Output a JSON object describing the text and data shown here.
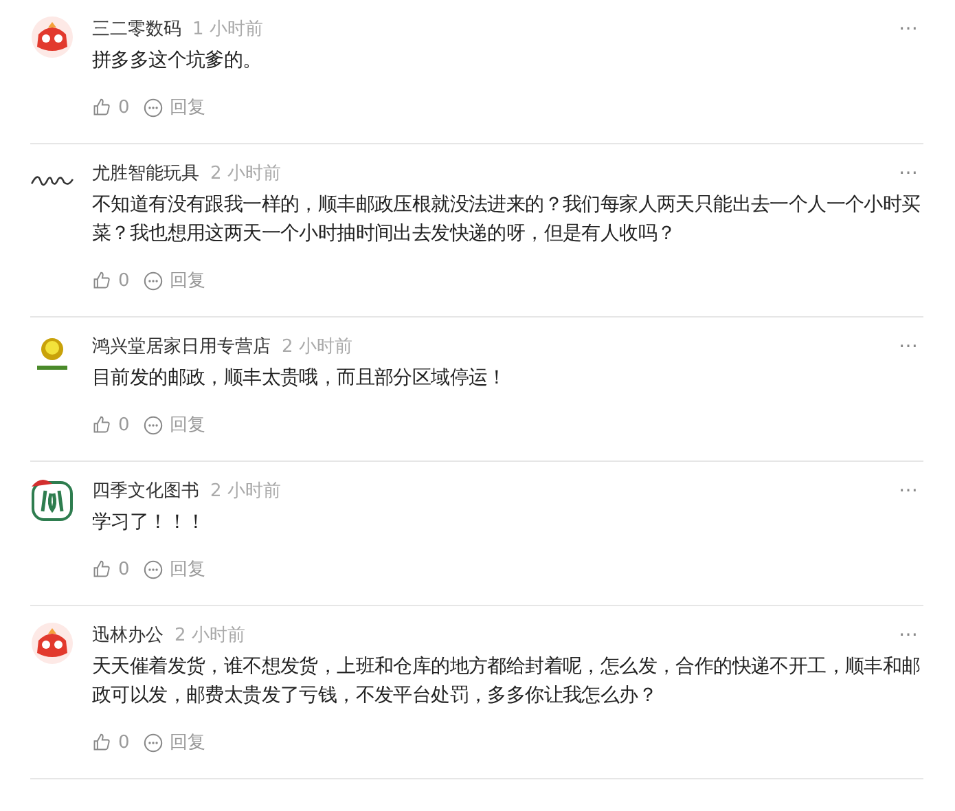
{
  "comments": [
    {
      "avatar": {
        "kind": "mascot"
      },
      "author": "三二零数码",
      "time": "1 小时前",
      "text": "拼多多这个坑爹的。",
      "likes": "0",
      "reply": "回复",
      "more": "⋯"
    },
    {
      "avatar": {
        "kind": "script"
      },
      "author": "尤胜智能玩具",
      "time": "2 小时前",
      "text": "不知道有没有跟我一样的，顺丰邮政压根就没法进来的？我们每家人两天只能出去一个人一个小时买菜？我也想用这两天一个小时抽时间出去发快递的呀，但是有人收吗？",
      "likes": "0",
      "reply": "回复",
      "more": "⋯"
    },
    {
      "avatar": {
        "kind": "fruit"
      },
      "author": "鸿兴堂居家日用专营店",
      "time": "2 小时前",
      "text": "目前发的邮政，顺丰太贵哦，而且部分区域停运！",
      "likes": "0",
      "reply": "回复",
      "more": "⋯"
    },
    {
      "avatar": {
        "kind": "book"
      },
      "author": "四季文化图书",
      "time": "2 小时前",
      "text": "学习了！！！",
      "likes": "0",
      "reply": "回复",
      "more": "⋯"
    },
    {
      "avatar": {
        "kind": "mascot"
      },
      "author": "迅林办公",
      "time": "2 小时前",
      "text": "天天催着发货，谁不想发货，上班和仓库的地方都给封着呢，怎么发，合作的快递不开工，顺丰和邮政可以发，邮费太贵发了亏钱，不发平台处罚，多多你让我怎么办？",
      "likes": "0",
      "reply": "回复",
      "more": "⋯"
    }
  ]
}
